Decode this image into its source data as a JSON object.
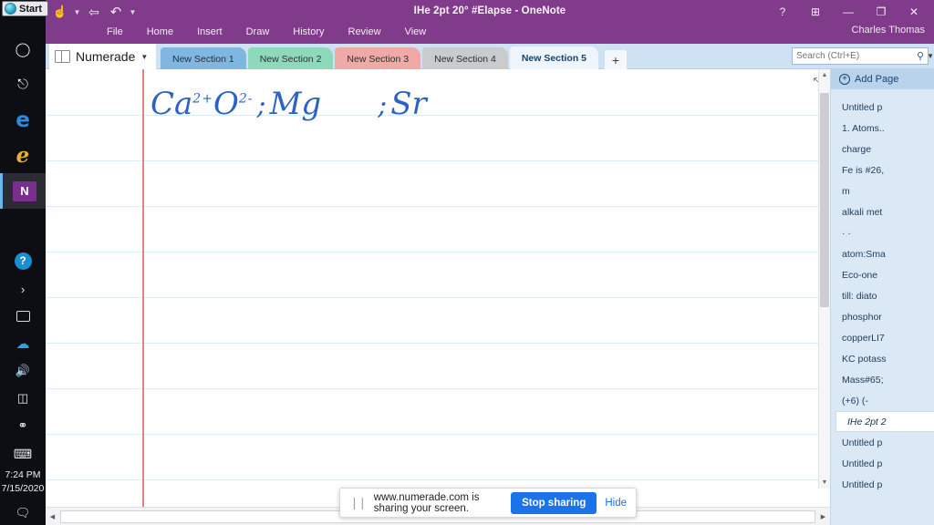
{
  "taskbar": {
    "start_label": "Start",
    "items": [
      {
        "name": "cortana-icon",
        "glyph": "○"
      },
      {
        "name": "task-view-icon",
        "glyph": "⌸"
      },
      {
        "name": "edge-chromium-icon",
        "glyph": "e"
      },
      {
        "name": "edge-legacy-icon",
        "glyph": "e"
      },
      {
        "name": "onenote-icon",
        "glyph": "N"
      }
    ],
    "tray": [
      {
        "name": "help-icon",
        "glyph": "?"
      },
      {
        "name": "show-hidden-icons-chevron",
        "glyph": "›"
      },
      {
        "name": "screen-share-tray-icon",
        "glyph": "⬛"
      },
      {
        "name": "onedrive-icon",
        "glyph": "☁"
      },
      {
        "name": "volume-icon",
        "glyph": "🔊"
      },
      {
        "name": "battery-icon",
        "glyph": "▭"
      },
      {
        "name": "network-icon",
        "glyph": "☈"
      },
      {
        "name": "touch-keyboard-icon",
        "glyph": "⌨"
      }
    ],
    "time": "7:24 PM",
    "date": "7/15/2020",
    "action_center_icon": "💬"
  },
  "window": {
    "title": "IHe 2pt 20° #Elapse - OneNote",
    "user": "Charles Thomas",
    "quick_access": [
      {
        "name": "touch-mode-icon",
        "glyph": "☝"
      },
      {
        "name": "back-icon",
        "glyph": "⬅"
      },
      {
        "name": "undo-icon",
        "glyph": "↶"
      }
    ],
    "controls": [
      {
        "name": "help-button",
        "glyph": "?"
      },
      {
        "name": "ribbon-display-options-button",
        "glyph": "⬒"
      },
      {
        "name": "minimize-button",
        "glyph": "—"
      },
      {
        "name": "restore-button",
        "glyph": "❐"
      },
      {
        "name": "close-button",
        "glyph": "✕"
      }
    ],
    "ribbon_tabs": [
      "File",
      "Home",
      "Insert",
      "Draw",
      "History",
      "Review",
      "View"
    ]
  },
  "sections": {
    "notebook_name": "Numerade",
    "tabs": [
      {
        "label": "New Section 1",
        "color": "#7fb6e2",
        "active": false
      },
      {
        "label": "New Section 2",
        "color": "#8fd9bb",
        "active": false
      },
      {
        "label": "New Section 3",
        "color": "#efa9a6",
        "active": false
      },
      {
        "label": "New Section 4",
        "color": "#c9cbcd",
        "active": false
      },
      {
        "label": "New Section 5",
        "color": "#eef5fc",
        "active": true
      }
    ],
    "add_section_label": "+"
  },
  "search": {
    "placeholder": "Search (Ctrl+E)",
    "icon": "⌕",
    "caret": "▾"
  },
  "page": {
    "ink_text": "CaO ; Mg ; Sr",
    "ink_parts": {
      "ca": "Ca",
      "ca_charge": "2+",
      "o": "O",
      "o_charge": "2-",
      "sep1": ";",
      "mg": "Mg",
      "sep2": ";",
      "sr": "Sr"
    },
    "expand_icon": "⤡"
  },
  "pagelist": {
    "add_page_label": "Add Page",
    "pages": [
      {
        "label": "Untitled p",
        "selected": false
      },
      {
        "label": "1. Atoms..",
        "selected": false
      },
      {
        "label": "charge",
        "selected": false
      },
      {
        "label": "Fe is #26,",
        "selected": false
      },
      {
        "label": "m",
        "selected": false
      },
      {
        "label": "alkali met",
        "selected": false
      },
      {
        "label": "· ·",
        "selected": false
      },
      {
        "label": "atom:Sma",
        "selected": false
      },
      {
        "label": "Eco-one",
        "selected": false
      },
      {
        "label": "till: diato",
        "selected": false
      },
      {
        "label": "phosphor",
        "selected": false
      },
      {
        "label": "copperLI7",
        "selected": false
      },
      {
        "label": "KC potass",
        "selected": false
      },
      {
        "label": "Mass#65;",
        "selected": false
      },
      {
        "label": "(+6) (-",
        "selected": false
      },
      {
        "label": "IHe 2pt 2",
        "selected": true
      },
      {
        "label": "Untitled p",
        "selected": false
      },
      {
        "label": "Untitled p",
        "selected": false
      },
      {
        "label": "Untitled p",
        "selected": false
      }
    ]
  },
  "sharebar": {
    "message": "www.numerade.com is sharing your screen.",
    "stop_label": "Stop sharing",
    "hide_label": "Hide",
    "grip": "❘❘"
  },
  "colors": {
    "accent_purple": "#803b8a",
    "ink_blue": "#2b62c4",
    "chrome_blue": "#1a73e8",
    "margin_red": "#e8837c"
  }
}
